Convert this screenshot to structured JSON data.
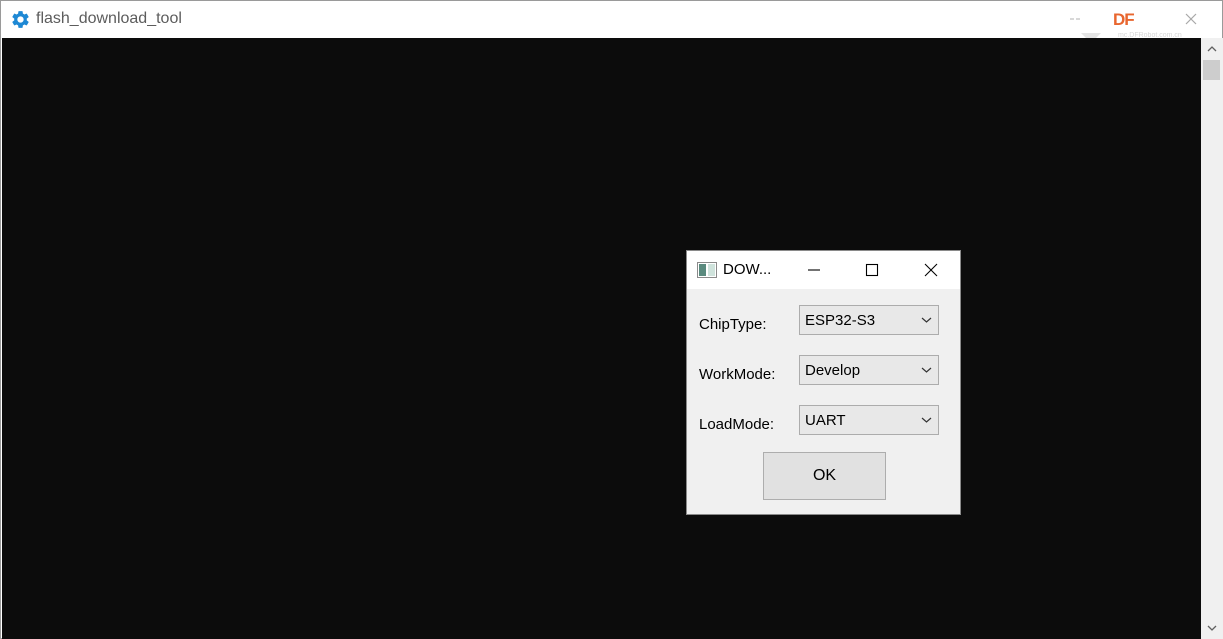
{
  "app": {
    "title": "flash_download_tool",
    "icon": "gear-icon",
    "brand_logo": "DF",
    "brand_url": "mc.DFRobot.com.cn"
  },
  "dialog": {
    "title": "DOW...",
    "icon": "window-icon",
    "fields": [
      {
        "label": "ChipType:",
        "value": "ESP32-S3"
      },
      {
        "label": "WorkMode:",
        "value": "Develop"
      },
      {
        "label": "LoadMode:",
        "value": "UART"
      }
    ],
    "ok_label": "OK"
  },
  "colors": {
    "console_bg": "#0c0c0c",
    "gear_icon": "#1e88d4",
    "brand": "#e8662f",
    "dialog_bg": "#f0f0f0"
  }
}
